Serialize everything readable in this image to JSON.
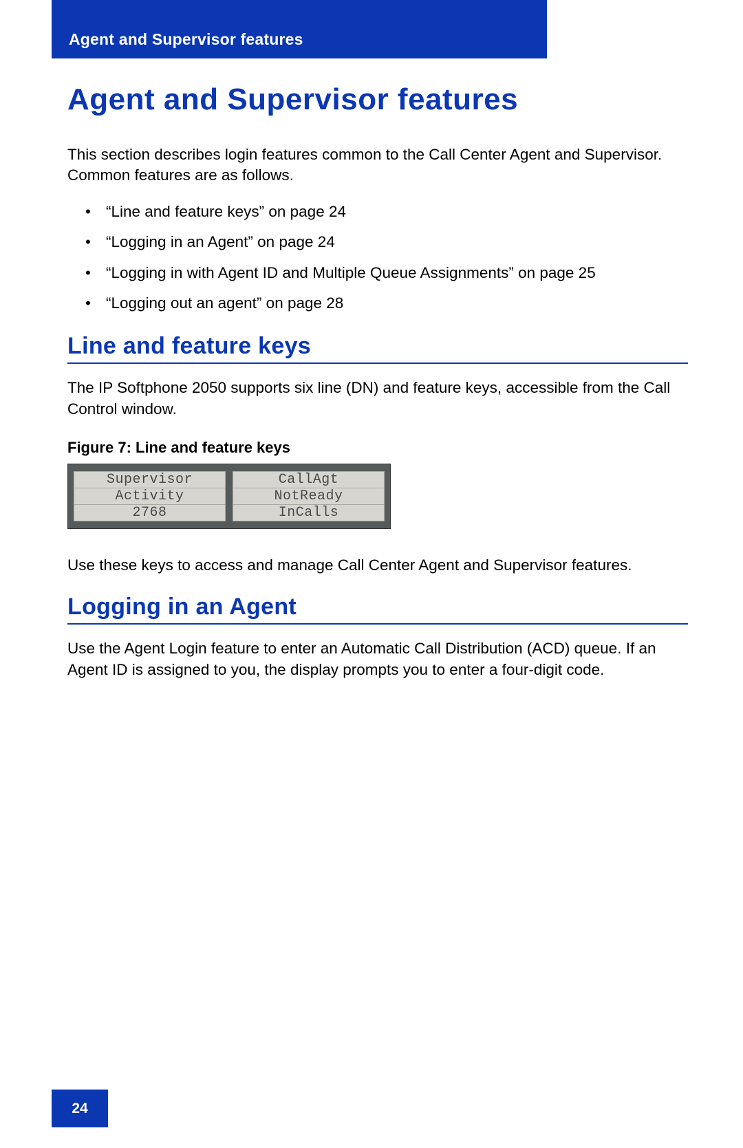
{
  "header": {
    "chapter": "Agent and Supervisor features"
  },
  "title": "Agent and Supervisor features",
  "intro": "This section describes login features common to the Call Center Agent and Supervisor. Common features are as follows.",
  "toc": {
    "items": [
      "“Line and feature keys” on page 24",
      "“Logging in an Agent” on page 24",
      "“Logging in with Agent ID and Multiple Queue Assignments” on page 25",
      "“Logging out an agent” on page 28"
    ]
  },
  "section1": {
    "heading": "Line and feature keys",
    "para": "The IP Softphone 2050 supports six line (DN) and feature keys, accessible from the Call Control window.",
    "figure_caption": "Figure 7: Line and feature keys",
    "keys": {
      "left": [
        "Supervisor",
        "Activity",
        "2768"
      ],
      "right": [
        "CallAgt",
        "NotReady",
        "InCalls"
      ]
    },
    "after": "Use these keys to access and manage Call Center Agent and Supervisor features."
  },
  "section2": {
    "heading": "Logging in an Agent",
    "para": "Use the Agent Login feature to enter an Automatic Call Distribution (ACD) queue. If an Agent ID is assigned to you, the display prompts you to enter a four-digit code."
  },
  "page_number": "24"
}
